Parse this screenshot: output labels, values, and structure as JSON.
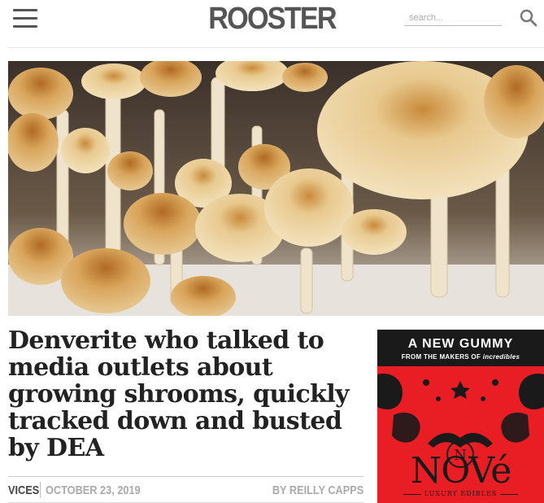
{
  "header": {
    "logo": "ROOSTER",
    "search_placeholder": "search..."
  },
  "hero": {
    "icon": "mushroom-photo"
  },
  "article": {
    "headline": "Denverite who talked to media outlets about growing shrooms, quickly tracked down and busted by DEA",
    "category": "VICES",
    "date": "OCTOBER 23, 2019",
    "author": "BY REILLY CAPPS"
  },
  "ad": {
    "title": "A NEW GUMMY",
    "subtitle_prefix": "FROM THE MAKERS OF",
    "subtitle_brand": "incredibles",
    "monogram": "N",
    "brand": "NOVé",
    "tagline": "LUXURY EDIBLES",
    "bg_color": "#e81e24"
  },
  "colors": {
    "logo": "#555555",
    "headline": "#222222",
    "meta_muted": "#aaaaaa"
  }
}
